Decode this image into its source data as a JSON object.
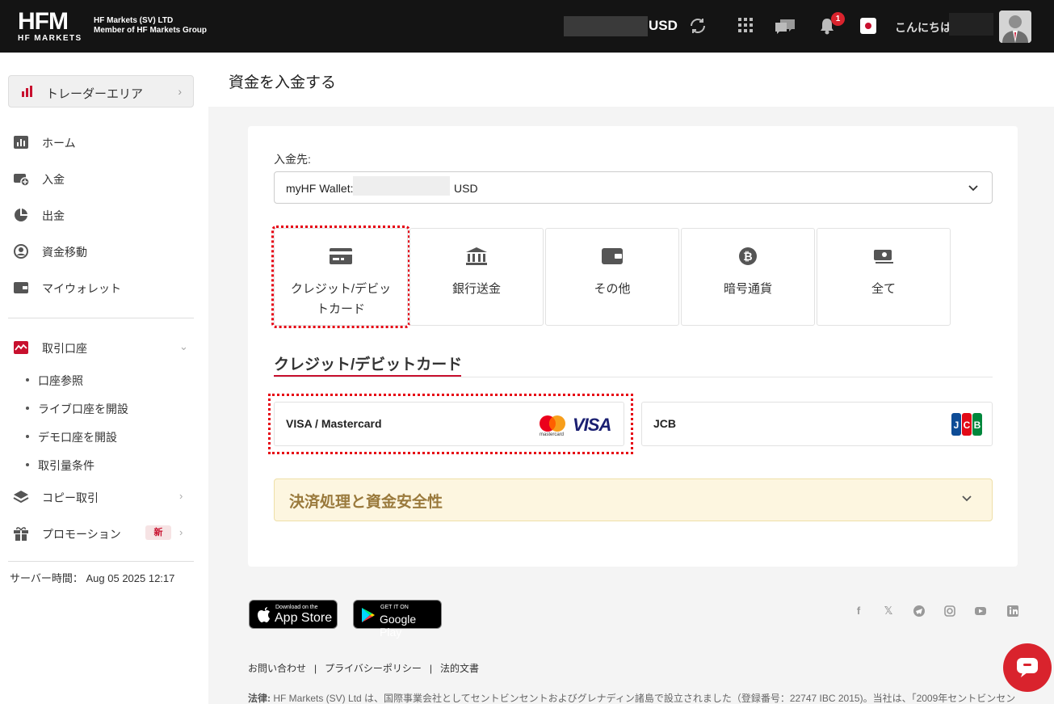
{
  "header": {
    "logo_main": "HFM",
    "logo_sub": "HF MARKETS",
    "company_line1": "HF Markets (SV) LTD",
    "company_line2": "Member of HF Markets Group",
    "balance_currency": "USD",
    "notification_count": "1",
    "greeting": "こんにちは"
  },
  "sidebar": {
    "trader_area": "トレーダーエリア",
    "items": [
      {
        "label": "ホーム"
      },
      {
        "label": "入金"
      },
      {
        "label": "出金"
      },
      {
        "label": "資金移動"
      },
      {
        "label": "マイウォレット"
      }
    ],
    "trading_accounts": "取引口座",
    "sub_items": [
      "口座参照",
      "ライブ口座を開設",
      "デモ口座を開設",
      "取引量条件"
    ],
    "copy_trading": "コピー取引",
    "promotion": "プロモーション",
    "new_badge": "新",
    "server_time_label": "サーバー時間：",
    "server_time_value": "Aug 05 2025 12:17"
  },
  "main": {
    "title": "資金を入金する",
    "deposit_to_label": "入金先:",
    "wallet_prefix": "myHF Wallet:",
    "wallet_currency": "USD",
    "methods": [
      {
        "label": "クレジット/デビットカード",
        "icon": "credit-card-icon"
      },
      {
        "label": "銀行送金",
        "icon": "bank-icon"
      },
      {
        "label": "その他",
        "icon": "wallet-icon"
      },
      {
        "label": "暗号通貨",
        "icon": "bitcoin-icon"
      },
      {
        "label": "全て",
        "icon": "cash-icon"
      }
    ],
    "section_title": "クレジット/デビットカード",
    "providers": [
      {
        "label": "VISA / Mastercard",
        "brand_mc": "mastercard",
        "brand_visa": "VISA"
      },
      {
        "label": "JCB",
        "brand": "JCB"
      }
    ],
    "accordion_label": "決済処理と資金安全性"
  },
  "footer": {
    "app_store_small": "Download on the",
    "app_store_big": "App Store",
    "google_small": "GET IT ON",
    "google_big": "Google Play",
    "links": [
      "お問い合わせ",
      "プライバシーポリシー",
      "法的文書"
    ],
    "legal_label": "法律:",
    "legal_text": "HF Markets (SV) Ltd は、国際事業会社としてセントビンセントおよびグレナディン諸島で設立されました（登録番号：22747 IBC 2015)。当社は、「2009年セントビンセン"
  },
  "colors": {
    "brand_red": "#c8102e",
    "topbar": "#141414",
    "highlight": "#e60012"
  }
}
